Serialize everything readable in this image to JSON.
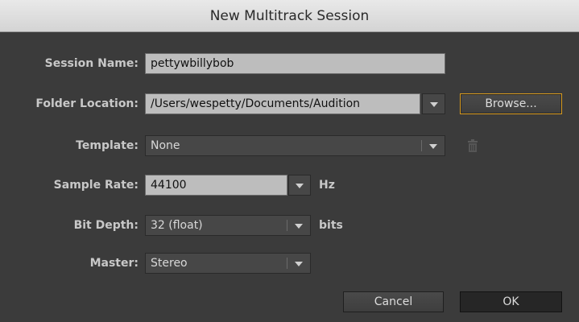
{
  "dialog": {
    "title": "New Multitrack Session"
  },
  "fields": {
    "session_name": {
      "label": "Session Name:",
      "value": "pettywbillybob"
    },
    "folder_location": {
      "label": "Folder Location:",
      "value": "/Users/wespetty/Documents/Audition"
    },
    "template": {
      "label": "Template:",
      "value": "None"
    },
    "sample_rate": {
      "label": "Sample Rate:",
      "value": "44100",
      "unit": "Hz"
    },
    "bit_depth": {
      "label": "Bit Depth:",
      "value": "32 (float)",
      "unit": "bits"
    },
    "master": {
      "label": "Master:",
      "value": "Stereo"
    }
  },
  "buttons": {
    "browse": "Browse...",
    "cancel": "Cancel",
    "ok": "OK"
  },
  "icons": {
    "delete_template": "trash-icon",
    "dropdown": "chevron-down-icon"
  },
  "colors": {
    "focus_ring": "#d79a1e"
  }
}
